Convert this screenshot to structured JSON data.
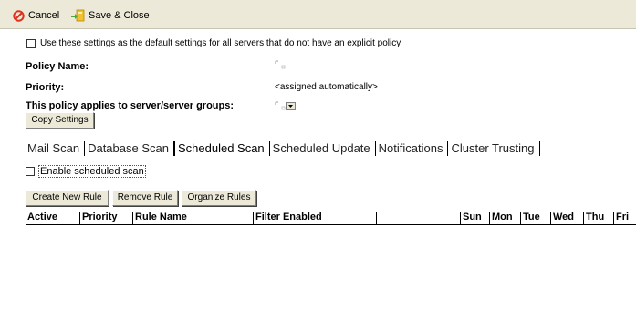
{
  "toolbar": {
    "cancel_label": "Cancel",
    "save_close_label": "Save & Close"
  },
  "defaults": {
    "checkbox_label": "Use these settings as the default settings for all servers that do not have an explicit policy",
    "checked": false
  },
  "fields": {
    "policy_name_label": "Policy Name:",
    "priority_label": "Priority:",
    "priority_value": "<assigned automatically>",
    "applies_to_label": "This policy applies to server/server groups:"
  },
  "copy_settings_label": "Copy Settings",
  "tabs": [
    {
      "label": "Mail Scan"
    },
    {
      "label": "Database Scan"
    },
    {
      "label": "Scheduled Scan",
      "active": true
    },
    {
      "label": "Scheduled Update"
    },
    {
      "label": "Notifications"
    },
    {
      "label": "Cluster Trusting"
    }
  ],
  "enable_scan": {
    "label": "Enable scheduled scan",
    "checked": false
  },
  "rule_buttons": {
    "create": "Create New Rule",
    "remove": "Remove Rule",
    "organize": "Organize Rules"
  },
  "table": {
    "columns": [
      "Active",
      "Priority",
      "Rule Name",
      "Filter Enabled",
      "",
      "Sun",
      "Mon",
      "Tue",
      "Wed",
      "Thu",
      "Fri"
    ],
    "rows": []
  },
  "colors": {
    "toolbar_bg": "#ece9d8",
    "cancel_red": "#e0301e",
    "save_yellow": "#f2c12e",
    "save_green": "#49a83a"
  }
}
